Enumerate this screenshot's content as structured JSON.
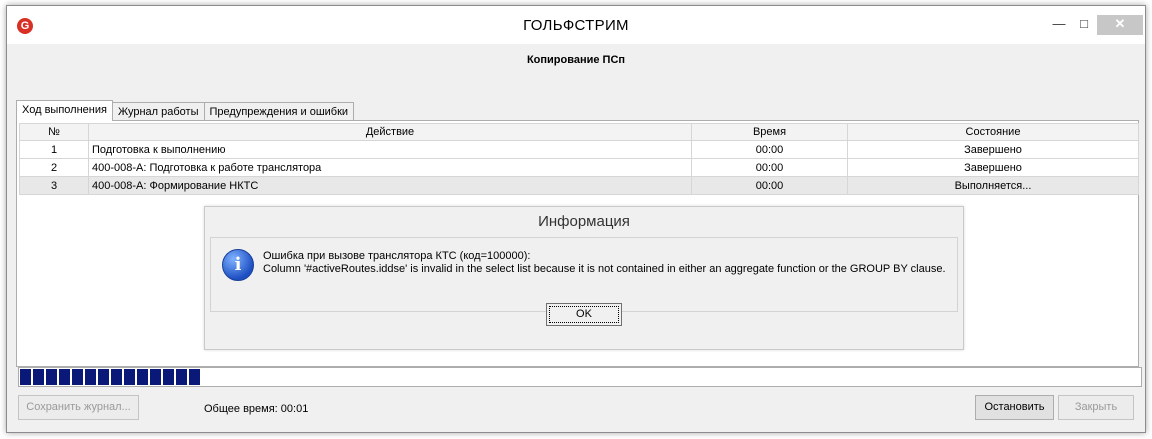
{
  "window": {
    "title": "ГОЛЬФСТРИМ",
    "app_icon_glyph": "G",
    "minimize_glyph": "—",
    "maximize_glyph": "□",
    "close_glyph": "✕"
  },
  "operation_title": "Копирование ПСп",
  "tabs": [
    {
      "label": "Ход выполнения",
      "active": true
    },
    {
      "label": "Журнал работы",
      "active": false
    },
    {
      "label": "Предупреждения и ошибки",
      "active": false
    }
  ],
  "grid": {
    "columns": [
      "№",
      "Действие",
      "Время",
      "Состояние"
    ],
    "rows": [
      {
        "num": "1",
        "action": "Подготовка к выполнению",
        "time": "00:00",
        "state": "Завершено"
      },
      {
        "num": "2",
        "action": "400-008-А: Подготовка к работе транслятора",
        "time": "00:00",
        "state": "Завершено"
      },
      {
        "num": "3",
        "action": "400-008-А: Формирование НКТС",
        "time": "00:00",
        "state": "Выполняется..."
      }
    ]
  },
  "dialog": {
    "title": "Информация",
    "icon": "info-icon",
    "icon_glyph": "i",
    "message_line1": "Ошибка при вызове транслятора КТС (код=100000):",
    "message_line2": "Column '#activeRoutes.iddse' is invalid in the select list because it is not contained in either an aggregate function or the GROUP BY clause.",
    "ok_label": "OK"
  },
  "progress": {
    "fraction": 0.165
  },
  "footer": {
    "save_log_label": "Сохранить журнал...",
    "total_time_label": "Общее время: 00:01",
    "stop_label": "Остановить",
    "close_label": "Закрыть"
  },
  "colors": {
    "progress": "#0a1878",
    "accent_close": "#c7c7c7"
  }
}
